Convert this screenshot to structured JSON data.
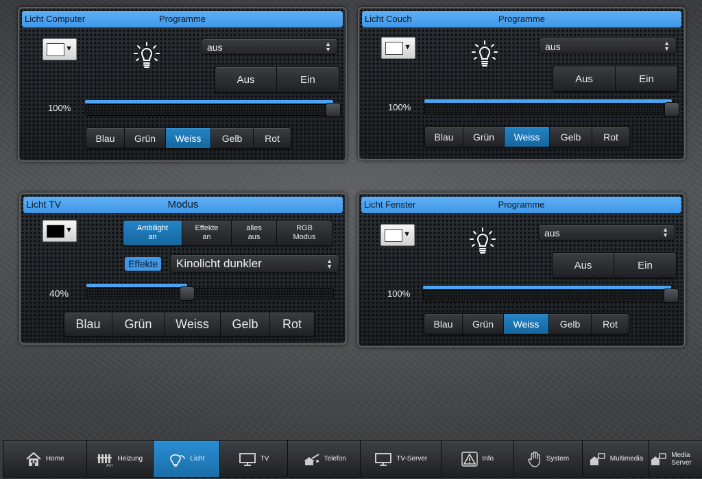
{
  "panels": {
    "computer": {
      "name": "Licht Computer",
      "header_center": "Programme",
      "color_swatch": "#ffffff",
      "program_select": "aus",
      "aus_label": "Aus",
      "ein_label": "Ein",
      "brightness_text": "100%",
      "brightness_value": 100,
      "colors": [
        "Blau",
        "Grün",
        "Weiss",
        "Gelb",
        "Rot"
      ],
      "active_color": "Weiss"
    },
    "couch": {
      "name": "Licht Couch",
      "header_center": "Programme",
      "color_swatch": "#ffffff",
      "program_select": "aus",
      "aus_label": "Aus",
      "ein_label": "Ein",
      "brightness_text": "100%",
      "brightness_value": 100,
      "colors": [
        "Blau",
        "Grün",
        "Weiss",
        "Gelb",
        "Rot"
      ],
      "active_color": "Weiss"
    },
    "tv": {
      "name": "Licht TV",
      "header_center": "Modus",
      "color_swatch": "#000000",
      "modes": [
        {
          "line1": "Ambilight",
          "line2": "an"
        },
        {
          "line1": "Effekte",
          "line2": "an"
        },
        {
          "line1": "alles",
          "line2": "aus"
        },
        {
          "line1": "RGB",
          "line2": "Modus"
        }
      ],
      "active_mode": "Ambilight",
      "effekte_label": "Effekte",
      "effekte_select": "Kinolicht dunkler",
      "brightness_text": "40%",
      "brightness_value": 40,
      "colors": [
        "Blau",
        "Grün",
        "Weiss",
        "Gelb",
        "Rot"
      ]
    },
    "fenster": {
      "name": "Licht Fenster",
      "header_center": "Programme",
      "color_swatch": "#ffffff",
      "program_select": "aus",
      "aus_label": "Aus",
      "ein_label": "Ein",
      "brightness_text": "100%",
      "brightness_value": 100,
      "colors": [
        "Blau",
        "Grün",
        "Weiss",
        "Gelb",
        "Rot"
      ],
      "active_color": "Weiss"
    }
  },
  "nav": {
    "items": [
      {
        "label": "Home",
        "icon": "house-icon"
      },
      {
        "label": "Heizung",
        "icon": "heater-icon"
      },
      {
        "label": "Licht",
        "icon": "lightbulb-icon"
      },
      {
        "label": "TV",
        "icon": "monitor-icon"
      },
      {
        "label": "Telefon",
        "icon": "phone-icon"
      },
      {
        "label": "TV-Server",
        "icon": "monitor-icon"
      },
      {
        "label": "Info",
        "icon": "warning-icon"
      },
      {
        "label": "System",
        "icon": "hand-icon"
      },
      {
        "label": "Multimedia",
        "icon": "media-icon"
      },
      {
        "label": "Media Server",
        "icon": "media-icon"
      }
    ],
    "active": "Licht"
  },
  "colors": {
    "accent": "#3f97e8",
    "active_button": "#1a76b4"
  }
}
